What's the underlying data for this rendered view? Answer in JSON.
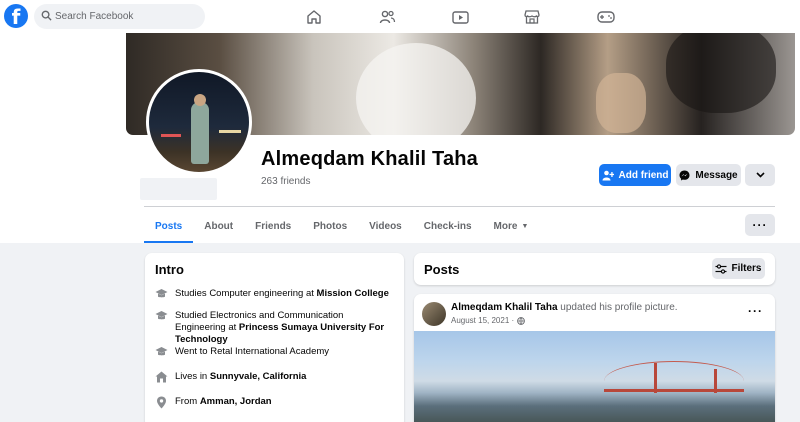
{
  "topbar": {
    "search_placeholder": "Search Facebook",
    "nav_icons": [
      "home-icon",
      "friends-icon",
      "watch-icon",
      "marketplace-icon",
      "gaming-icon"
    ]
  },
  "profile": {
    "name": "Almeqdam Khalil Taha",
    "friends_count": "263 friends",
    "add_friend_label": "Add friend",
    "message_label": "Message"
  },
  "tabs": {
    "posts": "Posts",
    "about": "About",
    "friends": "Friends",
    "photos": "Photos",
    "videos": "Videos",
    "checkins": "Check-ins",
    "more": "More"
  },
  "intro": {
    "title": "Intro",
    "items": [
      {
        "icon": "education-icon",
        "prefix": "Studies Computer engineering at ",
        "bold": "Mission College"
      },
      {
        "icon": "education-icon",
        "prefix": "Studied Electronics and Communication Engineering at ",
        "bold": "Princess Sumaya University For Technology"
      },
      {
        "icon": "education-icon",
        "prefix": "Went to Retal International Academy",
        "bold": ""
      },
      {
        "icon": "home-icon",
        "prefix": "Lives in ",
        "bold": "Sunnyvale, California"
      },
      {
        "icon": "location-pin-icon",
        "prefix": "From ",
        "bold": "Amman, Jordan"
      }
    ]
  },
  "posts": {
    "title": "Posts",
    "filters_label": "Filters",
    "post": {
      "author": "Almeqdam Khalil Taha",
      "action": " updated his profile picture.",
      "date": "August 15, 2021 ·"
    }
  },
  "colors": {
    "accent": "#1877f2",
    "background": "#f0f2f5"
  }
}
